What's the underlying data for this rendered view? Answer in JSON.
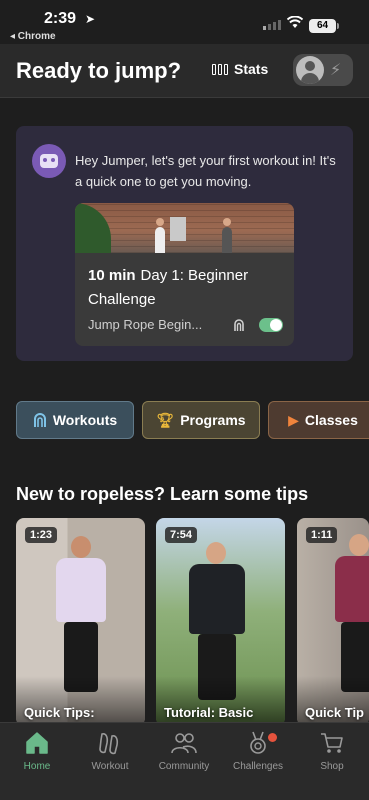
{
  "status_bar": {
    "time": "2:39",
    "back_app": "◂ Chrome",
    "battery": "64"
  },
  "header": {
    "title": "Ready to jump?",
    "stats_label": "Stats"
  },
  "welcome": {
    "message": "Hey Jumper, let's get your first workout in! It's a quick one to get you moving.",
    "workout": {
      "duration": "10 min",
      "title": "Day 1: Beginner Challenge",
      "subtitle": "Jump Rope Begin...",
      "toggle_on": true
    }
  },
  "categories": [
    {
      "label": "Workouts",
      "icon": "rope-icon",
      "color": "#3b4f5c"
    },
    {
      "label": "Programs",
      "icon": "trophy-icon",
      "color": "#4b4533"
    },
    {
      "label": "Classes",
      "icon": "play-icon",
      "color": "#4e3b30"
    }
  ],
  "tips_section": {
    "title": "New to ropeless? Learn some tips",
    "videos": [
      {
        "duration": "1:23",
        "label": "Quick Tips:"
      },
      {
        "duration": "7:54",
        "label": "Tutorial: Basic"
      },
      {
        "duration": "1:11",
        "label": "Quick Tip"
      }
    ]
  },
  "nav": [
    {
      "label": "Home",
      "icon": "home-icon",
      "active": true
    },
    {
      "label": "Workout",
      "icon": "shoes-icon",
      "active": false
    },
    {
      "label": "Community",
      "icon": "people-icon",
      "active": false
    },
    {
      "label": "Challenges",
      "icon": "medal-icon",
      "active": false,
      "notification": true
    },
    {
      "label": "Shop",
      "icon": "cart-icon",
      "active": false
    }
  ],
  "colors": {
    "accent_green": "#6ab98a",
    "card_purple": "#2e2b3d",
    "background": "#1e1e1e",
    "notification": "#e5533d"
  }
}
